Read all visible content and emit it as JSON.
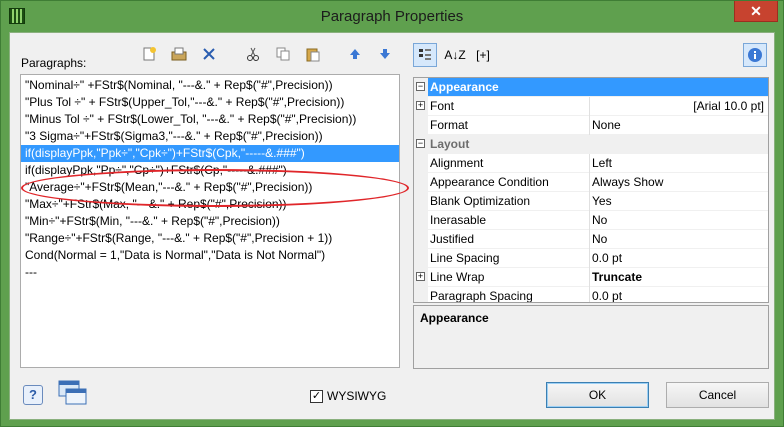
{
  "window": {
    "title": "Paragraph Properties",
    "close_label": "✕"
  },
  "left": {
    "label": "Paragraphs:",
    "toolbar_icons": [
      "new-icon",
      "insert-icon",
      "delete-icon",
      "cut-icon",
      "copy-icon",
      "paste-icon",
      "move-up-icon",
      "move-down-icon"
    ],
    "lines": [
      "\"Nominal÷\" +FStr$(Nominal, \"---&.\" + Rep$(\"#\",Precision))",
      "\"Plus Tol ÷\" + FStr$(Upper_Tol,\"---&.\" + Rep$(\"#\",Precision))",
      "\"Minus Tol ÷\" + FStr$(Lower_Tol, \"---&.\" + Rep$(\"#\",Precision))",
      "\"3 Sigma÷\"+FStr$(Sigma3,\"---&.\" + Rep$(\"#\",Precision))",
      "if(displayPpk,\"Ppk÷\",\"Cpk÷\")+FStr$(Cpk,\"-----&.###\")",
      "if(displayPpk,\"Pp÷\",\"Cp÷\")+FStr$(Cp,\"-----&.###\")",
      "\"Average÷\"+FStr$(Mean,\"---&.\" + Rep$(\"#\",Precision))",
      "\"Max÷\"+FStr$(Max, \"---&.\" + Rep$(\"#\",Precision))",
      "\"Min÷\"+FStr$(Min, \"---&.\" + Rep$(\"#\",Precision))",
      "\"Range÷\"+FStr$(Range, \"---&.\" + Rep$(\"#\",Precision + 1))",
      "Cond(Normal = 1,\"Data is Normal\",\"Data is Not Normal\")",
      "---"
    ],
    "selected_index": 4
  },
  "right": {
    "toolbar": {
      "sort_az_label": "A↓Z",
      "expand_label": "[+]"
    },
    "groups": [
      {
        "name": "Appearance",
        "selected": true
      },
      {
        "name": "Layout",
        "selected": false
      }
    ],
    "props": {
      "font": {
        "name": "Font",
        "value": "[Arial 10.0 pt]"
      },
      "format": {
        "name": "Format",
        "value": "None"
      },
      "alignment": {
        "name": "Alignment",
        "value": "Left"
      },
      "appearance_condition": {
        "name": "Appearance Condition",
        "value": "Always Show"
      },
      "blank_optimization": {
        "name": "Blank Optimization",
        "value": "Yes"
      },
      "inerasable": {
        "name": "Inerasable",
        "value": "No"
      },
      "justified": {
        "name": "Justified",
        "value": "No"
      },
      "line_spacing": {
        "name": "Line Spacing",
        "value": "0.0 pt"
      },
      "line_wrap": {
        "name": "Line Wrap",
        "value": "Truncate"
      },
      "paragraph_spacing": {
        "name": "Paragraph Spacing",
        "value": "0.0 pt"
      }
    },
    "description_title": "Appearance"
  },
  "footer": {
    "help_label": "?",
    "wysiwyg_label": "WYSIWYG",
    "wysiwyg_checked": true,
    "ok_label": "OK",
    "cancel_label": "Cancel"
  },
  "colors": {
    "accent": "#3399ff",
    "annotation": "#e0262a",
    "window_frame": "#5fa04e"
  }
}
